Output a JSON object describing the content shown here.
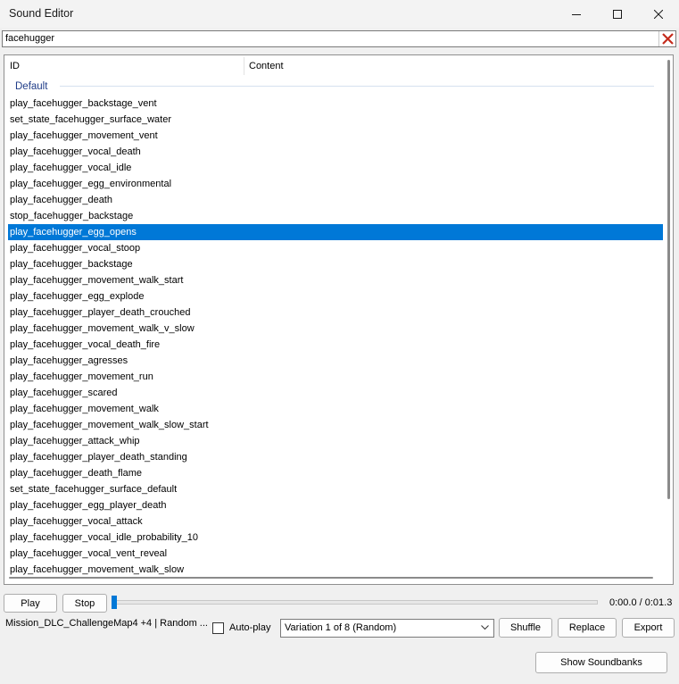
{
  "window": {
    "title": "Sound Editor"
  },
  "search": {
    "value": "facehugger"
  },
  "list": {
    "columns": [
      "ID",
      "Content"
    ],
    "group": "Default",
    "rows": [
      "play_facehugger_backstage_vent",
      "set_state_facehugger_surface_water",
      "play_facehugger_movement_vent",
      "play_facehugger_vocal_death",
      "play_facehugger_vocal_idle",
      "play_facehugger_egg_environmental",
      "play_facehugger_death",
      "stop_facehugger_backstage",
      "play_facehugger_egg_opens",
      "play_facehugger_vocal_stoop",
      "play_facehugger_backstage",
      "play_facehugger_movement_walk_start",
      "play_facehugger_egg_explode",
      "play_facehugger_player_death_crouched",
      "play_facehugger_movement_walk_v_slow",
      "play_facehugger_vocal_death_fire",
      "play_facehugger_agresses",
      "play_facehugger_movement_run",
      "play_facehugger_scared",
      "play_facehugger_movement_walk",
      "play_facehugger_movement_walk_slow_start",
      "play_facehugger_attack_whip",
      "play_facehugger_player_death_standing",
      "play_facehugger_death_flame",
      "set_state_facehugger_surface_default",
      "play_facehugger_egg_player_death",
      "play_facehugger_vocal_attack",
      "play_facehugger_vocal_idle_probability_10",
      "play_facehugger_vocal_vent_reveal",
      "play_facehugger_movement_walk_slow"
    ],
    "selected_index": 8
  },
  "playback": {
    "play_label": "Play",
    "stop_label": "Stop",
    "position_fraction": 0.0,
    "time": "0:00.0 / 0:01.3"
  },
  "bottom": {
    "status": "Mission_DLC_ChallengeMap4 +4  |  Random ...",
    "autoplay_label": "Auto-play",
    "autoplay_checked": false,
    "variation": "Variation 1 of 8  (Random)",
    "shuffle_label": "Shuffle",
    "replace_label": "Replace",
    "export_label": "Export",
    "soundbanks_label": "Show Soundbanks"
  },
  "colors": {
    "selection": "#0078d7",
    "group_text": "#1f3c88",
    "clear_icon": "#c42b1c"
  }
}
